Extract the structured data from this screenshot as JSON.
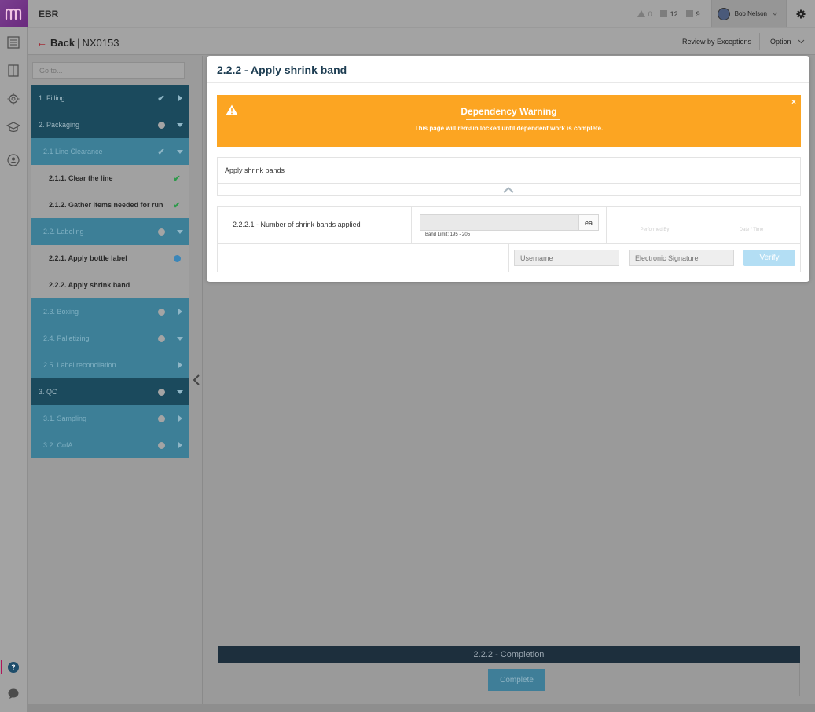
{
  "app": {
    "title": "EBR"
  },
  "topbar": {
    "stats": [
      {
        "icon": "warning-triangle-icon",
        "count": "0"
      },
      {
        "icon": "square-icon",
        "count": "12"
      },
      {
        "icon": "square-icon",
        "count": "9"
      }
    ],
    "user_name": "Bob Nelson"
  },
  "subheader": {
    "back_label": "Back",
    "record_id": "NX0153",
    "review_label": "Review by Exceptions",
    "option_label": "Option"
  },
  "sidebar": {
    "goto_placeholder": "Go to...",
    "items": [
      {
        "level": 1,
        "label": "1.  Filling",
        "status": "check",
        "expand": "right"
      },
      {
        "level": 1,
        "label": "2.  Packaging",
        "status": "dot",
        "expand": "down"
      },
      {
        "level": 2,
        "label": "2.1  Line Clearance",
        "status": "check",
        "expand": "down"
      },
      {
        "level": 3,
        "label": "2.1.1.  Clear the line",
        "status": "check-green",
        "expand": ""
      },
      {
        "level": 3,
        "label": "2.1.2.  Gather items needed for run",
        "status": "check-green",
        "expand": ""
      },
      {
        "level": 2,
        "label": "2.2.  Labeling",
        "status": "dot",
        "expand": "down"
      },
      {
        "level": 3,
        "label": "2.2.1.  Apply bottle label",
        "status": "dot-blue",
        "expand": ""
      },
      {
        "level": 3,
        "label": "2.2.2.  Apply shrink band",
        "status": "",
        "expand": ""
      },
      {
        "level": 2,
        "label": "2.3.  Boxing",
        "status": "dot",
        "expand": "right"
      },
      {
        "level": 2,
        "label": "2.4.  Palletizing",
        "status": "dot",
        "expand": "down"
      },
      {
        "level": 2,
        "label": "2.5.  Label reconcilation",
        "status": "",
        "expand": "right"
      },
      {
        "level": 1,
        "label": "3.  QC",
        "status": "dot",
        "expand": "down"
      },
      {
        "level": 2,
        "label": "3.1.  Sampling",
        "status": "dot",
        "expand": "right"
      },
      {
        "level": 2,
        "label": "3.2.  CofA",
        "status": "dot",
        "expand": "right"
      }
    ]
  },
  "modal": {
    "title": "2.2.2 - Apply shrink band",
    "warning": {
      "title": "Dependency Warning",
      "message": "This page will remain locked until dependent work is complete.",
      "close": "×",
      "color": "#fca522"
    },
    "task_label": "Apply shrink bands",
    "step": {
      "name": "2.2.2.1 - Number of shrink bands applied",
      "unit": "ea",
      "band_limit": "Band Limit: 195 - 205",
      "performed_by": "Performed By",
      "date_time": "Date / Time"
    },
    "username_placeholder": "Username",
    "signature_placeholder": "Electronic Signature",
    "verify_label": "Verify"
  },
  "completion": {
    "title": "2.2.2 - Completion",
    "button": "Complete"
  },
  "rail": {
    "help_label": "?"
  }
}
